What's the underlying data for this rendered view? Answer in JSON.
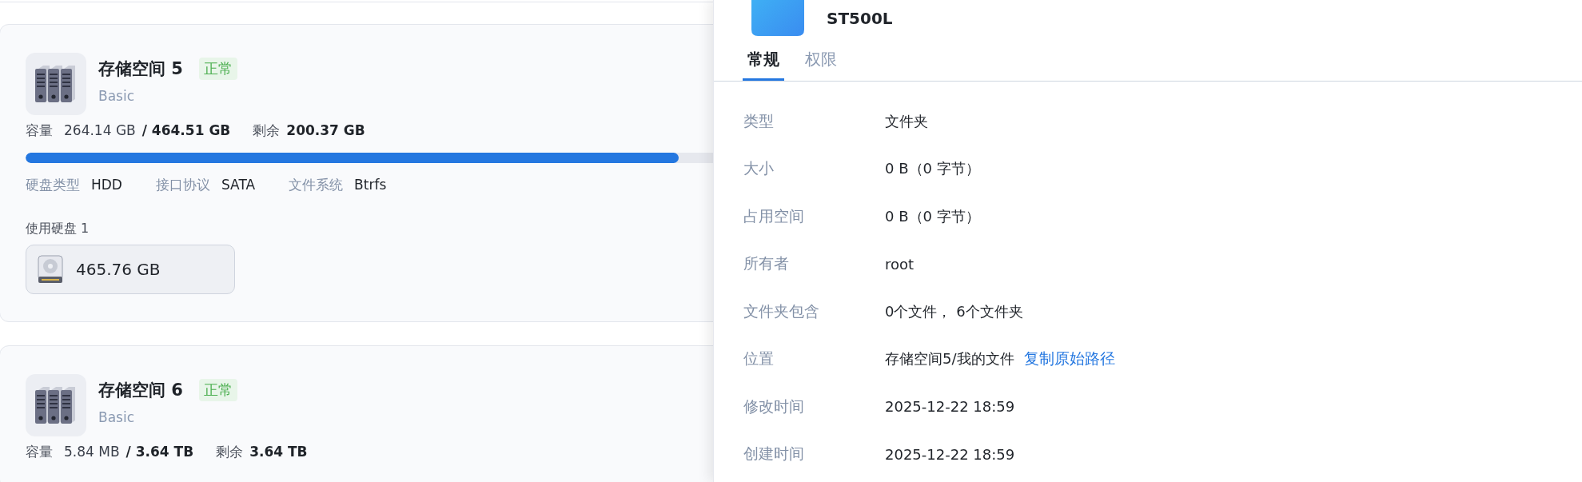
{
  "storage_pools": [
    {
      "name": "存储空间 5",
      "status": "正常",
      "raid": "Basic",
      "capacity_label": "容量",
      "used": "264.14 GB",
      "total": "/ 464.51 GB",
      "free_label": "剩余",
      "free": "200.37 GB",
      "level": 0.569,
      "specs": [
        {
          "label": "硬盘类型",
          "value": "HDD"
        },
        {
          "label": "接口协议",
          "value": "SATA"
        },
        {
          "label": "文件系统",
          "value": "Btrfs"
        }
      ],
      "disks_label": "使用硬盘 1",
      "disks": [
        {
          "size": "465.76 GB"
        }
      ]
    },
    {
      "name": "存储空间 6",
      "status": "正常",
      "raid": "Basic",
      "capacity_label": "容量",
      "used": "5.84 MB",
      "total": "/ 3.64 TB",
      "free_label": "剩余",
      "free": "3.64 TB"
    }
  ],
  "drawer": {
    "title": "ST500L",
    "tabs": [
      {
        "label": "常规",
        "selected": true
      },
      {
        "label": "权限",
        "selected": false
      }
    ],
    "properties": [
      {
        "label": "类型",
        "value": "文件夹"
      },
      {
        "label": "大小",
        "value": "0 B（0 字节）"
      },
      {
        "label": "占用空间",
        "value": "0 B（0 字节）"
      },
      {
        "label": "所有者",
        "value": "root"
      },
      {
        "label": "文件夹包含",
        "value": "0个文件， 6个文件夹"
      },
      {
        "label": "位置",
        "value": "存储空间5/我的文件",
        "link": "复制原始路径"
      },
      {
        "label": "修改时间",
        "value": "2025-12-22 18:59"
      },
      {
        "label": "创建时间",
        "value": "2025-12-22 18:59"
      }
    ]
  }
}
